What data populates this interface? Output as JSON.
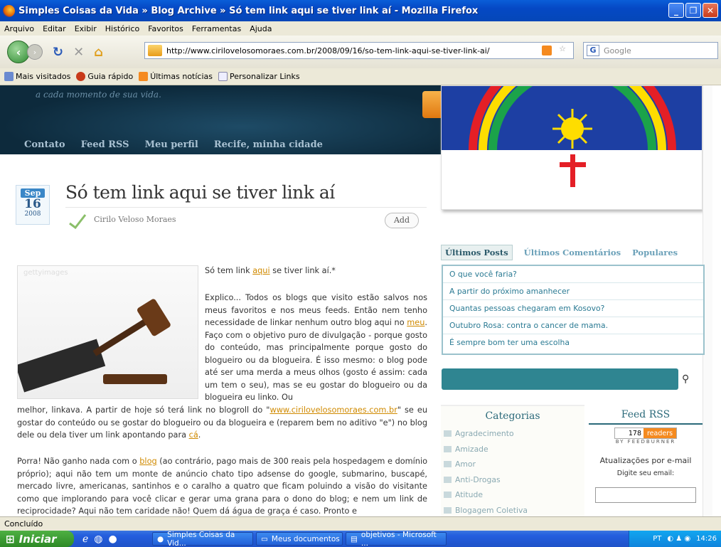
{
  "window": {
    "title": "Simples Coisas da Vida » Blog Archive » Só tem link aqui se tiver link aí - Mozilla Firefox"
  },
  "menu": [
    "Arquivo",
    "Editar",
    "Exibir",
    "Histórico",
    "Favoritos",
    "Ferramentas",
    "Ajuda"
  ],
  "nav": {
    "url": "http://www.cirilovelosomoraes.com.br/2008/09/16/so-tem-link-aqui-se-tiver-link-ai/",
    "search_placeholder": "Google"
  },
  "bookmarks": [
    "Mais visitados",
    "Guia rápido",
    "Últimas notícias",
    "Personalizar Links"
  ],
  "blog": {
    "tagline": "a cada momento de sua vida.",
    "nav": [
      "Contato",
      "Feed RSS",
      "Meu perfil",
      "Recife, minha cidade"
    ]
  },
  "post": {
    "month": "Sep",
    "day": "16",
    "year": "2008",
    "title": "Só tem link aqui se tiver link aí",
    "author": "Cirilo Veloso Moraes",
    "add_label": "Add",
    "image_watermark": "gettyimages",
    "p1_pre": "Só tem link ",
    "p1_link": "aqui",
    "p1_post": " se tiver link aí.*",
    "p2_pre": "Explico... Todos os blogs que visito estão salvos nos meus favoritos e nos meus feeds. Então nem tenho necessidade de linkar nenhum outro blog aqui no ",
    "p2_link": "meu",
    "p2_post": ". Faço com o objetivo puro de divulgação - porque gosto do conteúdo, mas principalmente porque gosto do blogueiro ou da blogueira. É isso mesmo: o blog pode até ser uma merda a meus olhos (gosto é assim: cada um tem o seu), mas se eu gostar do blogueiro ou da blogueira eu linko. Ou",
    "p2b_pre": "melhor, linkava. A partir de hoje só terá link no blogroll do \"",
    "p2b_link": "www.cirilovelosomoraes.com.br",
    "p2b_mid": "\" se eu gostar do conteúdo ou se gostar do blogueiro ou da blogueira e (reparem bem no aditivo \"e\") no blog dele ou dela tiver um link apontando para ",
    "p2b_link2": "cá",
    "p2b_end": ".",
    "p3_pre": "Porra! Não ganho nada com o ",
    "p3_link": "blog",
    "p3_post": " (ao contrário, pago mais de 300 reais pela hospedagem e domínio próprio); aqui não tem um monte de anúncio chato tipo adsense do google, submarino, buscapé, mercado livre, americanas, santinhos e o caralho a quatro que ficam poluindo a visão do visitante como que implorando para você clicar e gerar uma grana para o dono do blog; e nem um link de reciprocidade? Aqui não tem caridade não! Quem dá água de graça é caso. Pronto e"
  },
  "sidebar": {
    "tabs": [
      "Últimos Posts",
      "Últimos Comentários",
      "Populares"
    ],
    "recent": [
      "O que você faria?",
      "A partir do próximo amanhecer",
      "Quantas pessoas chegaram em Kosovo?",
      "Outubro Rosa: contra o cancer de mama.",
      "É sempre bom ter uma escolha"
    ],
    "categories_title": "Categorias",
    "categories": [
      "Agradecimento",
      "Amizade",
      "Amor",
      "Anti-Drogas",
      "Atitude",
      "Blogagem Coletiva"
    ],
    "feed_title": "Feed RSS",
    "feed_count": "178",
    "feed_readers": "readers",
    "feed_by": "BY FEEDBURNER",
    "email_title": "Atualizações por e-mail",
    "email_label": "Digite seu email:"
  },
  "status": "Concluído",
  "taskbar": {
    "start": "Iniciar",
    "tasks": [
      "Simples Coisas da Vid...",
      "Meus documentos",
      "objetivos - Microsoft ..."
    ],
    "lang": "PT",
    "time": "14:26"
  }
}
